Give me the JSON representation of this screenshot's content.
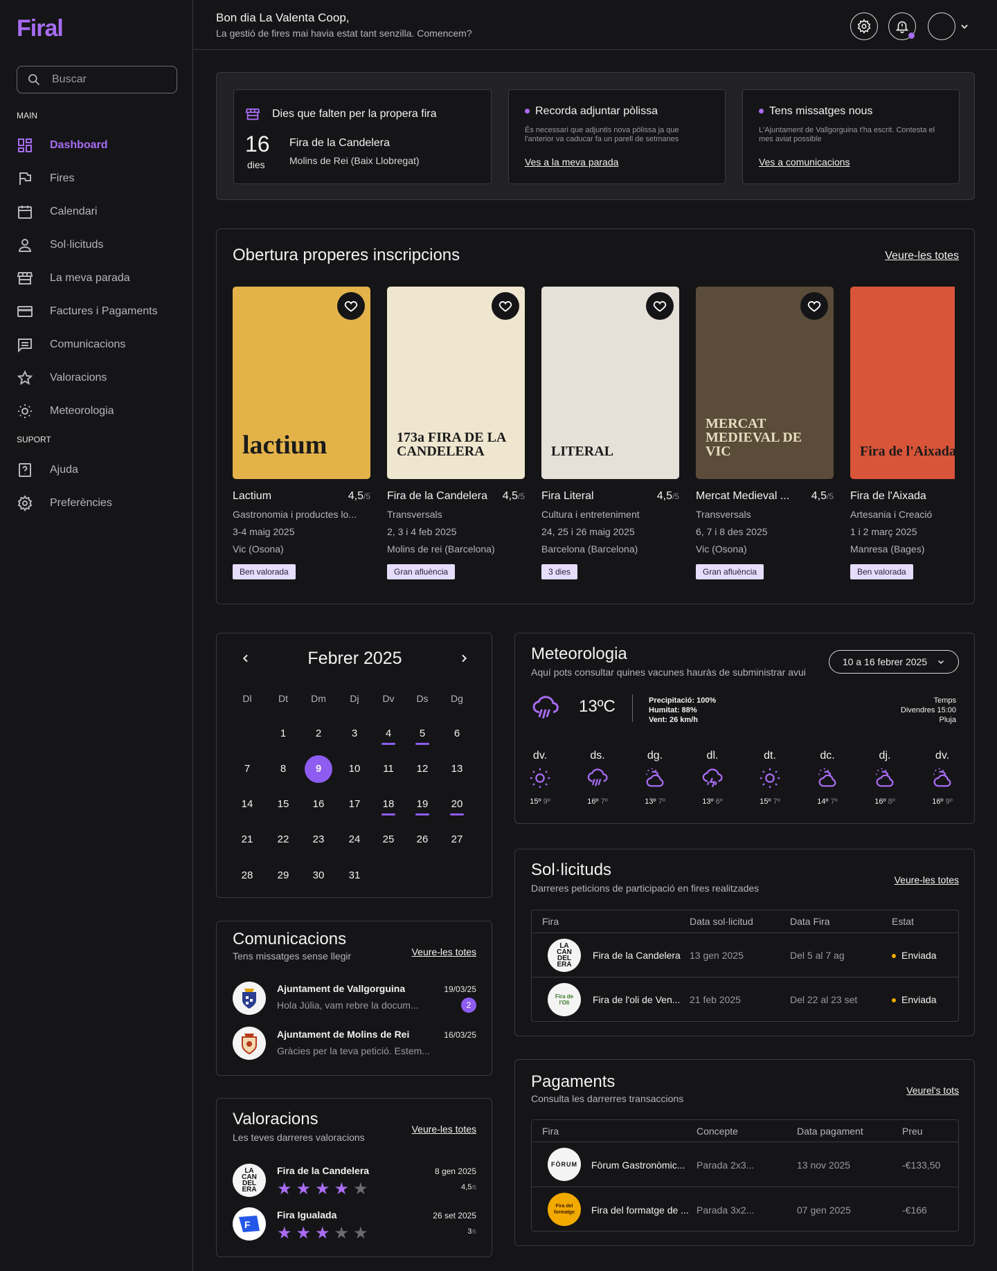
{
  "app": {
    "logo": "Firal"
  },
  "sidebar": {
    "search_placeholder": "Buscar",
    "section_main": "MAIN",
    "section_support": "SUPORT",
    "items": [
      {
        "label": "Dashboard",
        "icon": "dashboard-icon",
        "active": true
      },
      {
        "label": "Fires",
        "icon": "flag-icon"
      },
      {
        "label": "Calendari",
        "icon": "calendar-icon"
      },
      {
        "label": "Sol·licituds",
        "icon": "user-icon"
      },
      {
        "label": "La meva parada",
        "icon": "store-icon"
      },
      {
        "label": "Factures i Pagaments",
        "icon": "card-icon"
      },
      {
        "label": "Comunicacions",
        "icon": "message-icon"
      },
      {
        "label": "Valoracions",
        "icon": "star-icon"
      },
      {
        "label": "Meteorologia",
        "icon": "sun-icon"
      }
    ],
    "support_items": [
      {
        "label": "Ajuda",
        "icon": "help-icon"
      },
      {
        "label": "Preferències",
        "icon": "gear-icon"
      }
    ]
  },
  "header": {
    "greeting": "Bon dia La Valenta Coop,",
    "subtitle": "La gestió de fires mai havia estat tant senzilla. Comencem?"
  },
  "summary": {
    "next_fair": {
      "title": "Dies que falten per la propera fira",
      "days": "16",
      "days_label": "dies",
      "fair": "Fira de la Candelera",
      "place": "Molins de Rei (Baix Llobregat)"
    },
    "policy": {
      "title": "Recorda adjuntar pòlissa",
      "text": "És necessari que adjuntis nova pòlissa ja que l'anterior va caducar fa un parell de setmanes",
      "link": "Ves a la meva parada"
    },
    "messages": {
      "title": "Tens missatges nous",
      "text": "L'Ajuntament de Vallgorguina t'ha escrit. Contesta el mes aviat possible",
      "link": "Ves a comunicacions"
    }
  },
  "inscriptions": {
    "title": "Obertura properes inscripcions",
    "link": "Veure-les totes",
    "fairs": [
      {
        "name": "Lactium",
        "rating": "4,5",
        "of": "/5",
        "category": "Gastronomia i productes lo...",
        "dates": "3-4 maig 2025",
        "place": "Vic (Osona)",
        "tag": "Ben valorada",
        "poster_bg": "#e3b34a",
        "poster_text": "lactium"
      },
      {
        "name": "Fira de la Candelera",
        "rating": "4,5",
        "of": "/5",
        "category": "Transversals",
        "dates": "2, 3 i 4 feb 2025",
        "place": "Molins de rei (Barcelona)",
        "tag": "Gran afluència",
        "poster_bg": "#efe6d0",
        "poster_text": "173a FIRA DE LA CANDELERA"
      },
      {
        "name": "Fira Literal",
        "rating": "4,5",
        "of": "/5",
        "category": "Cultura i entreteniment",
        "dates": "24, 25 i 26 maig 2025",
        "place": "Barcelona (Barcelona)",
        "tag": "3 dies",
        "poster_bg": "#e5e0d8",
        "poster_text": "LITERAL"
      },
      {
        "name": "Mercat Medieval ...",
        "rating": "4,5",
        "of": "/5",
        "category": "Transversals",
        "dates": "6, 7 i 8 des 2025",
        "place": "Vic (Osona)",
        "tag": "Gran afluència",
        "poster_bg": "#5a4c38",
        "poster_text": "MERCAT MEDIEVAL DE VIC"
      },
      {
        "name": "Fira de l'Aixada",
        "rating": "",
        "of": "",
        "category": "Artesania i Creació",
        "dates": "1 i 2 març 2025",
        "place": "Manresa (Bages)",
        "tag": "Ben valorada",
        "poster_bg": "#d8553a",
        "poster_text": "Fira de l'Aixada"
      }
    ]
  },
  "calendar": {
    "month": "Febrer 2025",
    "weekdays": [
      "Dl",
      "Dt",
      "Dm",
      "Dj",
      "Dv",
      "Ds",
      "Dg"
    ],
    "weeks": [
      [
        "",
        "",
        "",
        "",
        "",
        "",
        ""
      ],
      [
        "",
        "1",
        "2",
        "3",
        "4",
        "5",
        "6"
      ],
      [
        "7",
        "8",
        "9",
        "10",
        "11",
        "12",
        "13"
      ],
      [
        "14",
        "15",
        "16",
        "17",
        "18",
        "19",
        "20"
      ],
      [
        "21",
        "22",
        "23",
        "24",
        "25",
        "26",
        "27"
      ],
      [
        "28",
        "29",
        "30",
        "31",
        "",
        "",
        ""
      ]
    ],
    "selected": "9",
    "marked": [
      "4",
      "5",
      "18",
      "19",
      "20"
    ]
  },
  "weather": {
    "title": "Meteorologia",
    "subtitle": "Aquí pots consultar quines vacunes hauràs de subministrar avui",
    "range": "10 a 16 febrer 2025",
    "temp": "13ºC",
    "precip": "Precipitació: 100%",
    "humidity": "Humitat: 88%",
    "wind": "Vent: 26 km/h",
    "label": "Temps",
    "when": "Divendres 15:00",
    "condition": "Pluja",
    "days": [
      {
        "d": "dv.",
        "icon": "sun-icon",
        "max": "15º",
        "min": "9º"
      },
      {
        "d": "ds.",
        "icon": "rain-icon",
        "max": "16º",
        "min": "7º"
      },
      {
        "d": "dg.",
        "icon": "partly-cloudy-icon",
        "max": "13º",
        "min": "7º"
      },
      {
        "d": "dl.",
        "icon": "storm-icon",
        "max": "13º",
        "min": "6º"
      },
      {
        "d": "dt.",
        "icon": "sun-icon",
        "max": "15º",
        "min": "7º"
      },
      {
        "d": "dc.",
        "icon": "partly-cloudy-icon",
        "max": "14º",
        "min": "7º"
      },
      {
        "d": "dj.",
        "icon": "partly-cloudy-icon",
        "max": "16º",
        "min": "8º"
      },
      {
        "d": "dv.",
        "icon": "partly-cloudy-icon",
        "max": "16º",
        "min": "9º"
      }
    ]
  },
  "requests": {
    "title": "Sol·licituds",
    "subtitle": "Darreres peticions de participació en fires realitzades",
    "link": "Veure-les totes",
    "cols": [
      "Fira",
      "Data sol·licitud",
      "Data Fira",
      "Estat"
    ],
    "rows": [
      {
        "logo": "LA CAN DEL ERA",
        "fair": "Fira de la Candelera",
        "date": "13 gen 2025",
        "fair_date": "Del 5 al 7 ag",
        "status": "Enviada"
      },
      {
        "logo": "Fira de l'Oli",
        "fair": "Fira de l'oli de Ven...",
        "date": "21 feb 2025",
        "fair_date": "Del 22 al 23 set",
        "status": "Enviada"
      }
    ]
  },
  "communications": {
    "title": "Comunicacions",
    "subtitle": "Tens missatges sense llegir",
    "link": "Veure-les totes",
    "items": [
      {
        "from": "Ajuntament de Vallgorguina",
        "text": "Hola Júlia, vam rebre la docum...",
        "date": "19/03/25",
        "badge": "2"
      },
      {
        "from": "Ajuntament de Molins de Rei",
        "text": "Gràcies per la teva petició. Estem...",
        "date": "16/03/25",
        "badge": ""
      }
    ]
  },
  "payments": {
    "title": "Pagaments",
    "subtitle": "Consulta les darrerres transaccions",
    "link": "Veurel's tots",
    "cols": [
      "Fira",
      "Concepte",
      "Data pagament",
      "Preu"
    ],
    "rows": [
      {
        "logo": "FÒRUM",
        "fair": "Fòrum Gastronòmic...",
        "concept": "Parada 2x3...",
        "date": "13 nov 2025",
        "price": "-€133,50"
      },
      {
        "logo": "Fira del formatge",
        "fair": "Fira del formatge de ...",
        "concept": "Parada 3x2...",
        "date": "07 gen 2025",
        "price": "-€166"
      }
    ]
  },
  "ratings": {
    "title": "Valoracions",
    "subtitle": "Les teves darreres valoracions",
    "link": "Veure-les totes",
    "items": [
      {
        "logo": "LA CAN DEL ERA",
        "fair": "Fira de la Candelera",
        "date": "8 gen 2025",
        "score": "4,5",
        "of": "/5",
        "stars": 4
      },
      {
        "logo": "F",
        "fair": "Fira Igualada",
        "date": "26 set 2025",
        "score": "3",
        "of": "/5",
        "stars": 3
      }
    ]
  },
  "colors": {
    "accent": "#a86cf2",
    "accent_dark": "#8e5cf0",
    "bg": "#151517",
    "panel": "#222225",
    "tag": "#e5ddf9",
    "status": "#f2a900"
  }
}
